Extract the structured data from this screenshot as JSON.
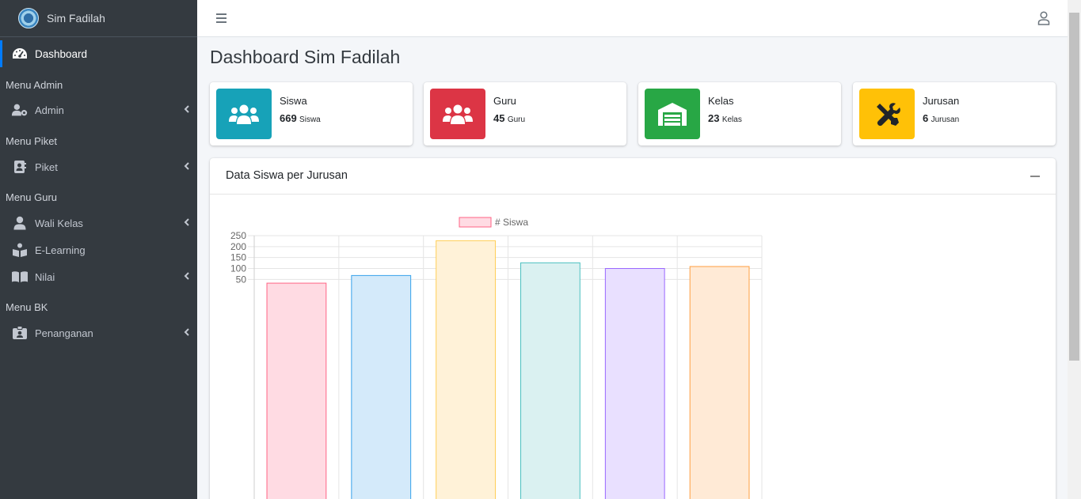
{
  "brand": {
    "name": "Sim Fadilah"
  },
  "sidebar": {
    "dashboard": "Dashboard",
    "sections": [
      {
        "header": "Menu Admin",
        "items": [
          {
            "label": "Admin",
            "icon": "users-cog-icon",
            "caret": true
          }
        ]
      },
      {
        "header": "Menu Piket",
        "items": [
          {
            "label": "Piket",
            "icon": "address-book-icon",
            "caret": true
          }
        ]
      },
      {
        "header": "Menu Guru",
        "items": [
          {
            "label": "Wali Kelas",
            "icon": "user-icon",
            "caret": true
          },
          {
            "label": "E-Learning",
            "icon": "book-reader-icon",
            "caret": false
          },
          {
            "label": "Nilai",
            "icon": "book-open-icon",
            "caret": true
          }
        ]
      },
      {
        "header": "Menu BK",
        "items": [
          {
            "label": "Penanganan",
            "icon": "id-badge-icon",
            "caret": true
          }
        ]
      }
    ]
  },
  "page": {
    "title": "Dashboard Sim Fadilah"
  },
  "stats": [
    {
      "label": "Siswa",
      "value": "669",
      "unit": "Siswa",
      "color": "#17a2b8",
      "icon": "users-icon"
    },
    {
      "label": "Guru",
      "value": "45",
      "unit": "Guru",
      "color": "#dc3545",
      "icon": "users-icon"
    },
    {
      "label": "Kelas",
      "value": "23",
      "unit": "Kelas",
      "color": "#28a745",
      "icon": "warehouse-icon"
    },
    {
      "label": "Jurusan",
      "value": "6",
      "unit": "Jurusan",
      "color": "#ffc107",
      "icon": "tools-icon"
    }
  ],
  "card": {
    "title": "Data Siswa per Jurusan"
  },
  "chart_data": {
    "type": "bar",
    "categories": [
      "",
      "",
      "",
      "",
      "",
      ""
    ],
    "series": [
      {
        "name": "# Siswa",
        "values": [
          33,
          68,
          227,
          126,
          100,
          109
        ]
      }
    ],
    "bar_colors": [
      "#ffdbe3",
      "#d4eafa",
      "#fff2d8",
      "#daf1f1",
      "#e9e0ff",
      "#ffead6"
    ],
    "border_colors": [
      "#ff6384",
      "#36a2eb",
      "#ffce56",
      "#4bc0c0",
      "#9966ff",
      "#ff9f40"
    ],
    "yticks": [
      "250",
      "200",
      "150",
      "100",
      "50"
    ],
    "ylim": [
      0,
      250
    ],
    "grid": true,
    "legend": "top"
  }
}
